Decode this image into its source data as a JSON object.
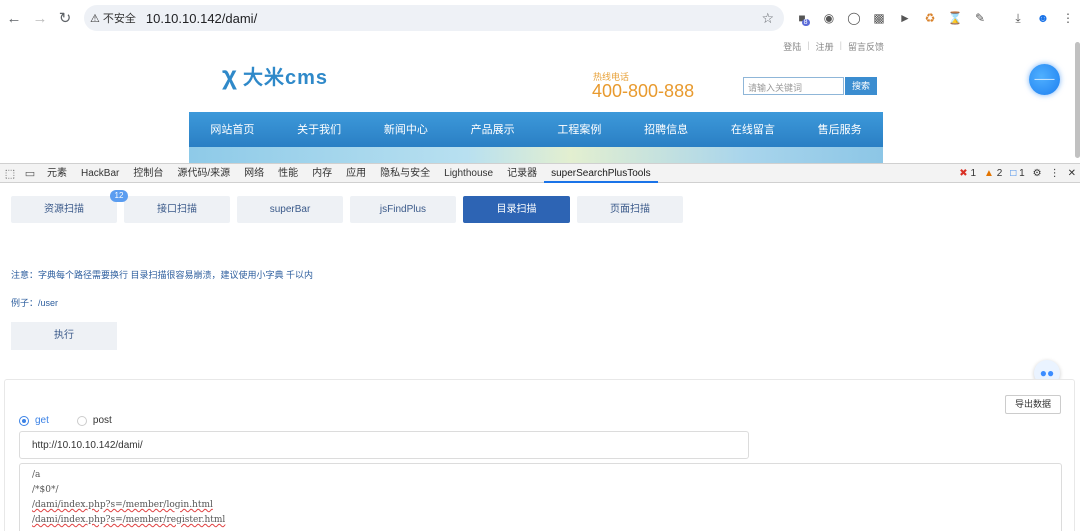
{
  "browser": {
    "security_label": "不安全",
    "url": "10.10.10.142/dami/",
    "ext_badge": "8"
  },
  "site": {
    "top_links": [
      "登陆",
      "注册",
      "留言反馈"
    ],
    "logo_text": "大米cms",
    "hotline_label": "热线电话",
    "hotline": "400-800-888",
    "search_placeholder": "请输入关键词",
    "search_button": "搜索",
    "nav": [
      "网站首页",
      "关于我们",
      "新闻中心",
      "产品展示",
      "工程案例",
      "招聘信息",
      "在线留言",
      "售后服务"
    ]
  },
  "devtools": {
    "tabs": [
      "元素",
      "HackBar",
      "控制台",
      "源代码/来源",
      "网络",
      "性能",
      "内存",
      "应用",
      "隐私与安全",
      "Lighthouse",
      "记录器",
      "superSearchPlusTools"
    ],
    "active_tab": "superSearchPlusTools",
    "errors": "1",
    "warnings": "2",
    "messages": "1"
  },
  "tool": {
    "buttons": [
      "资源扫描",
      "接口扫描",
      "superBar",
      "jsFindPlus",
      "目录扫描",
      "页面扫描"
    ],
    "active_button": "目录扫描",
    "badge_count": "12",
    "note": "注意：字典每个路径需要换行 目录扫描很容易崩溃，建议使用小字典 千以内",
    "example": "例子：/user",
    "run_button": "执行",
    "export_button": "导出数据",
    "method_get": "get",
    "method_post": "post",
    "url_value": "http://10.10.10.142/dami/",
    "dict_lines": [
      "/a",
      "/*$0*/",
      "/dami/index.php?s=/member/login.html",
      "/dami/index.php?s=/member/register.html"
    ]
  },
  "colors": {
    "accent": "#2d64b4",
    "site_blue": "#2f89c9",
    "hotline_orange": "#e89a2e"
  }
}
